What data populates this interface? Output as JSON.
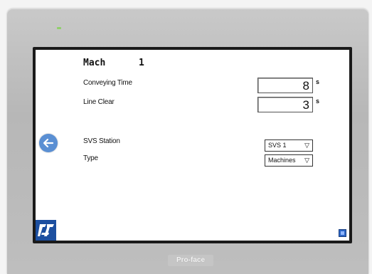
{
  "machine": {
    "label": "Mach",
    "number": "1"
  },
  "conveying_time": {
    "label": "Conveying Time",
    "value": "8",
    "unit": "s"
  },
  "line_clear": {
    "label": "Line Clear",
    "value": "3",
    "unit": "s"
  },
  "svs_station": {
    "label": "SVS Station",
    "selected": "SVS 1"
  },
  "type": {
    "label": "Type",
    "selected": "Machines"
  },
  "dropdown_arrow": "▽",
  "icons": {
    "back": "back-arrow-icon",
    "logo": "brand-logo-icon",
    "corner": "window-icon"
  },
  "colors": {
    "back_button": "#5a8fd3",
    "logo": "#1c4fa0",
    "corner_button": "#2d66c6"
  },
  "brand": {
    "text": "Pro-face"
  }
}
